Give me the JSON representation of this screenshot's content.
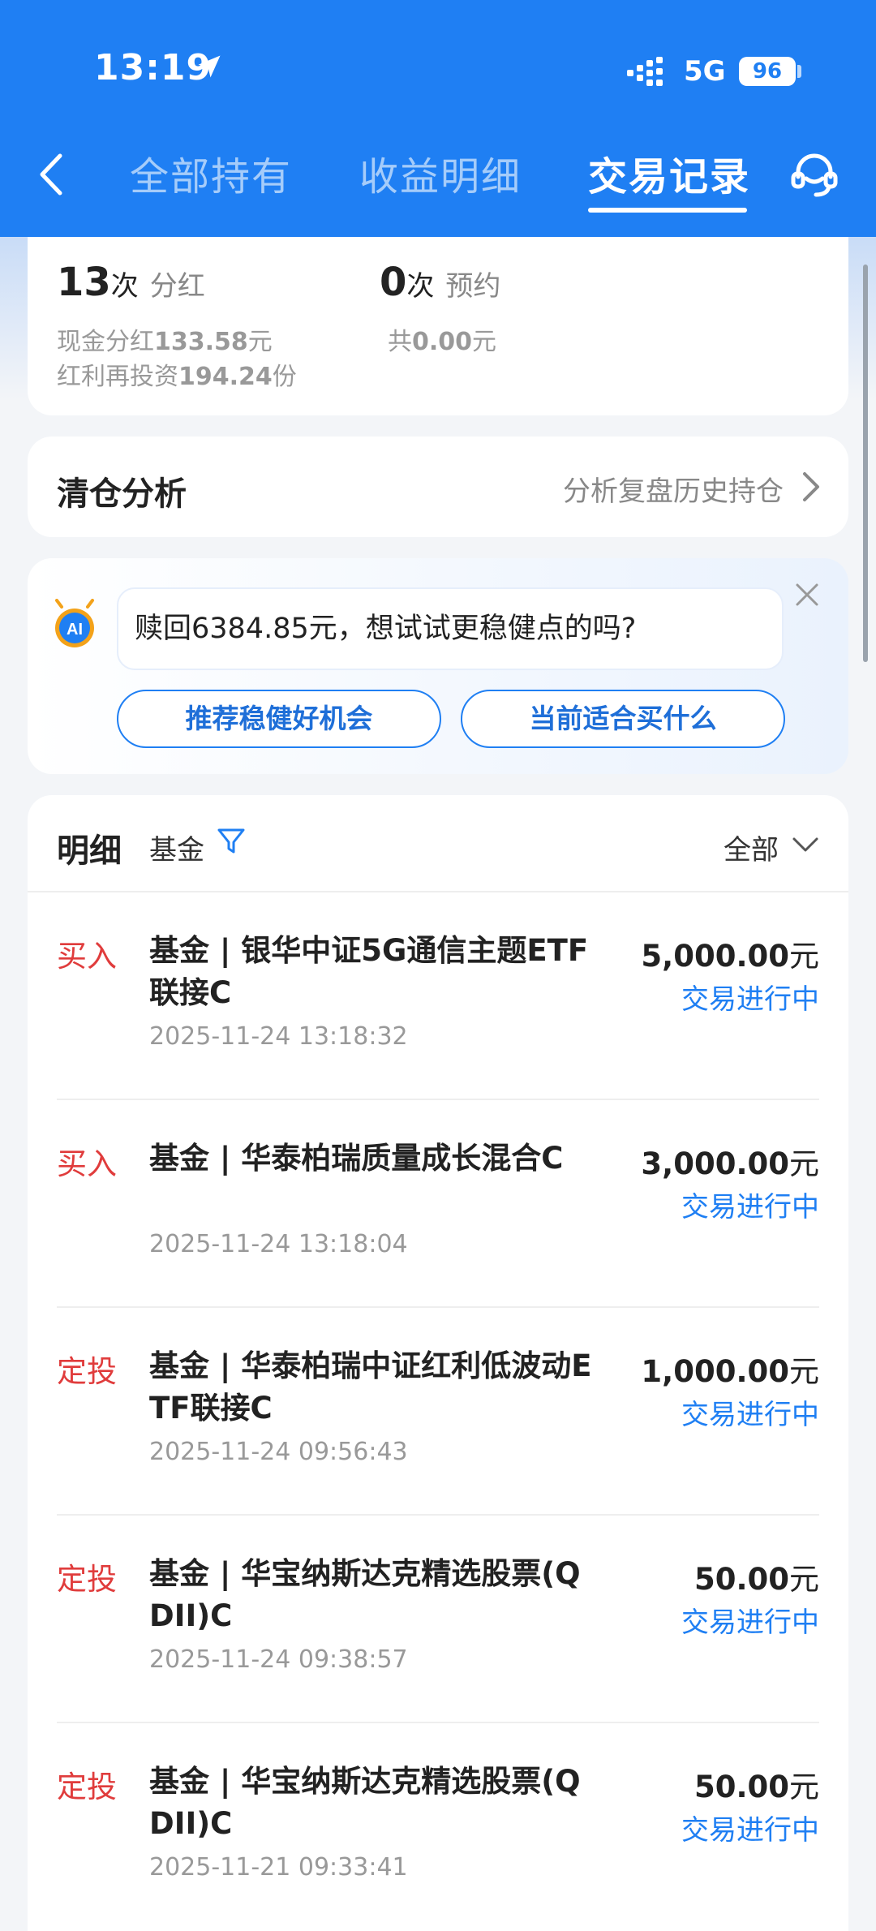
{
  "status_bar": {
    "time": "13:19",
    "network": "5G",
    "battery": "96"
  },
  "nav": {
    "tabs": [
      {
        "label": "全部持有"
      },
      {
        "label": "收益明细"
      },
      {
        "label": "交易记录",
        "active": true
      }
    ]
  },
  "summary": {
    "dividend": {
      "count": "13",
      "unit": "次",
      "label": "分红",
      "cash_prefix": "现金分红",
      "cash_value": "133.58",
      "cash_unit": "元",
      "reinvest_prefix": "红利再投资",
      "reinvest_value": "194.24",
      "reinvest_unit": "份"
    },
    "reserve": {
      "count": "0",
      "unit": "次",
      "label": "预约",
      "total_prefix": "共",
      "total_value": "0.00",
      "total_unit": "元"
    }
  },
  "clearance": {
    "title": "清仓分析",
    "link": "分析复盘历史持仓"
  },
  "ai_tip": {
    "message": "赎回6384.85元，想试试更稳健点的吗?",
    "button_left": "推荐稳健好机会",
    "button_right": "当前适合买什么"
  },
  "detail": {
    "title": "明细",
    "filter_label": "基金",
    "scope": "全部",
    "rows": [
      {
        "type": "买入",
        "name": "基金 | 银华中证5G通信主题ETF联接C",
        "date": "2025-11-24 13:18:32",
        "amount": "5,000.00",
        "unit": "元",
        "status": "交易进行中"
      },
      {
        "type": "买入",
        "name": "基金 | 华泰柏瑞质量成长混合C",
        "date": "2025-11-24 13:18:04",
        "amount": "3,000.00",
        "unit": "元",
        "status": "交易进行中"
      },
      {
        "type": "定投",
        "name": "基金 | 华泰柏瑞中证红利低波动ETF联接C",
        "date": "2025-11-24 09:56:43",
        "amount": "1,000.00",
        "unit": "元",
        "status": "交易进行中"
      },
      {
        "type": "定投",
        "name": "基金 | 华宝纳斯达克精选股票(QDII)C",
        "date": "2025-11-24 09:38:57",
        "amount": "50.00",
        "unit": "元",
        "status": "交易进行中"
      },
      {
        "type": "定投",
        "name": "基金 | 华宝纳斯达克精选股票(QDII)C",
        "date": "2025-11-21 09:33:41",
        "amount": "50.00",
        "unit": "元",
        "status": "交易进行中"
      }
    ]
  },
  "colors": {
    "brand_blue": "#1f7ff3",
    "buy_red": "#e03c3c"
  },
  "icons": [
    "location-arrow-icon",
    "signal-icon",
    "back-icon",
    "customer-service-icon",
    "chevron-right-icon",
    "ai-assistant-icon",
    "close-icon",
    "filter-icon",
    "chevron-down-icon"
  ]
}
